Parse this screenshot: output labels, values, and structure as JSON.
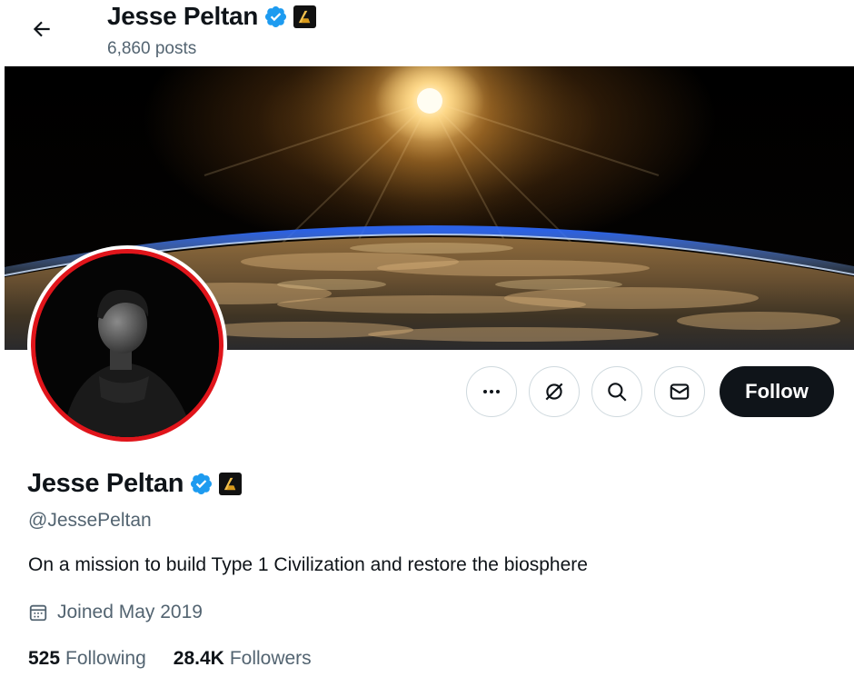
{
  "header": {
    "name": "Jesse Peltan",
    "posts": "6,860 posts"
  },
  "profile": {
    "name": "Jesse Peltan",
    "handle": "@JessePeltan",
    "bio": "On a mission to build Type 1 Civilization and restore the biosphere",
    "joined": "Joined May 2019",
    "following_count": "525",
    "following_label": "Following",
    "followers_count": "28.4K",
    "followers_label": "Followers"
  },
  "actions": {
    "follow_label": "Follow",
    "more_icon": "more-icon",
    "grok_icon": "grok-icon",
    "search_icon": "search-icon",
    "message_icon": "message-icon"
  },
  "colors": {
    "verified": "#1d9bf0",
    "avatar_ring": "#e0151b",
    "follow_bg": "#0f1419",
    "secondary_text": "#536471"
  }
}
